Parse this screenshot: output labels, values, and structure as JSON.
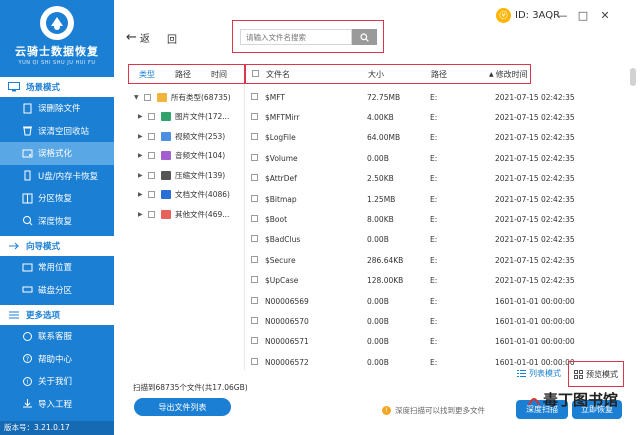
{
  "sidebar": {
    "logo_title": "云骑士数据恢复",
    "logo_sub": "YUN QI SHI SHU JU HUI FU",
    "sections": [
      {
        "title": "场景模式",
        "items": [
          "误删除文件",
          "误清空回收站",
          "误格式化",
          "U盘/内存卡恢复",
          "分区恢复",
          "深度恢复"
        ]
      },
      {
        "title": "向导模式",
        "items": [
          "常用位置",
          "磁盘分区"
        ]
      },
      {
        "title": "更多选项",
        "items": [
          "联系客服",
          "帮助中心",
          "关于我们",
          "导入工程"
        ]
      }
    ],
    "version": "版本号：3.21.0.17"
  },
  "topbar": {
    "back_label": "返",
    "home_label": "回",
    "search_placeholder": "请输入文件名搜索",
    "user_id": "ID: 3AQR"
  },
  "tree": {
    "tabs": [
      "类型",
      "路径",
      "时间"
    ],
    "items": [
      {
        "label": "所有类型(68735)",
        "icon": "folder-icon",
        "color": "#f2b43a"
      },
      {
        "label": "图片文件(172...",
        "icon": "image-file-icon",
        "color": "#2fa36b"
      },
      {
        "label": "视频文件(253)",
        "icon": "video-file-icon",
        "color": "#4a8fe0"
      },
      {
        "label": "音频文件(104)",
        "icon": "audio-file-icon",
        "color": "#a35fd0"
      },
      {
        "label": "压缩文件(139)",
        "icon": "archive-file-icon",
        "color": "#555555"
      },
      {
        "label": "文档文件(4086)",
        "icon": "document-file-icon",
        "color": "#2b6fd6"
      },
      {
        "label": "其他文件(469...",
        "icon": "other-file-icon",
        "color": "#e8615a"
      }
    ]
  },
  "list": {
    "headers": {
      "name": "文件名",
      "size": "大小",
      "path": "路径",
      "time": "修改时间"
    },
    "rows": [
      {
        "name": "$MFT",
        "size": "72.75MB",
        "path": "E:",
        "time": "2021-07-15 02:42:35"
      },
      {
        "name": "$MFTMirr",
        "size": "4.00KB",
        "path": "E:",
        "time": "2021-07-15 02:42:35"
      },
      {
        "name": "$LogFile",
        "size": "64.00MB",
        "path": "E:",
        "time": "2021-07-15 02:42:35"
      },
      {
        "name": "$Volume",
        "size": "0.00B",
        "path": "E:",
        "time": "2021-07-15 02:42:35"
      },
      {
        "name": "$AttrDef",
        "size": "2.50KB",
        "path": "E:",
        "time": "2021-07-15 02:42:35"
      },
      {
        "name": "$Bitmap",
        "size": "1.25MB",
        "path": "E:",
        "time": "2021-07-15 02:42:35"
      },
      {
        "name": "$Boot",
        "size": "8.00KB",
        "path": "E:",
        "time": "2021-07-15 02:42:35"
      },
      {
        "name": "$BadClus",
        "size": "0.00B",
        "path": "E:",
        "time": "2021-07-15 02:42:35"
      },
      {
        "name": "$Secure",
        "size": "286.64KB",
        "path": "E:",
        "time": "2021-07-15 02:42:35"
      },
      {
        "name": "$UpCase",
        "size": "128.00KB",
        "path": "E:",
        "time": "2021-07-15 02:42:35"
      },
      {
        "name": "N00006569",
        "size": "0.00B",
        "path": "E:",
        "time": "1601-01-01 00:00:00"
      },
      {
        "name": "N00006570",
        "size": "0.00B",
        "path": "E:",
        "time": "1601-01-01 00:00:00"
      },
      {
        "name": "N00006571",
        "size": "0.00B",
        "path": "E:",
        "time": "1601-01-01 00:00:00"
      },
      {
        "name": "N00006572",
        "size": "0.00B",
        "path": "E:",
        "time": "1601-01-01 00:00:00"
      }
    ]
  },
  "bottom": {
    "list_mode": "列表模式",
    "preview_mode": "预览模式",
    "scan_info": "扫描到68735个文件(共17.06GB)",
    "export_label": "导出文件列表",
    "deep_tip": "深度扫描可以找到更多文件",
    "deep_scan_label": "深度扫描",
    "recover_label": "立即恢复",
    "watermark": "毒丁图书馆"
  },
  "colors": {
    "primary": "#1b7fd3",
    "highlight": "#d9374b",
    "sidebar_active": "#5aa7e6"
  }
}
